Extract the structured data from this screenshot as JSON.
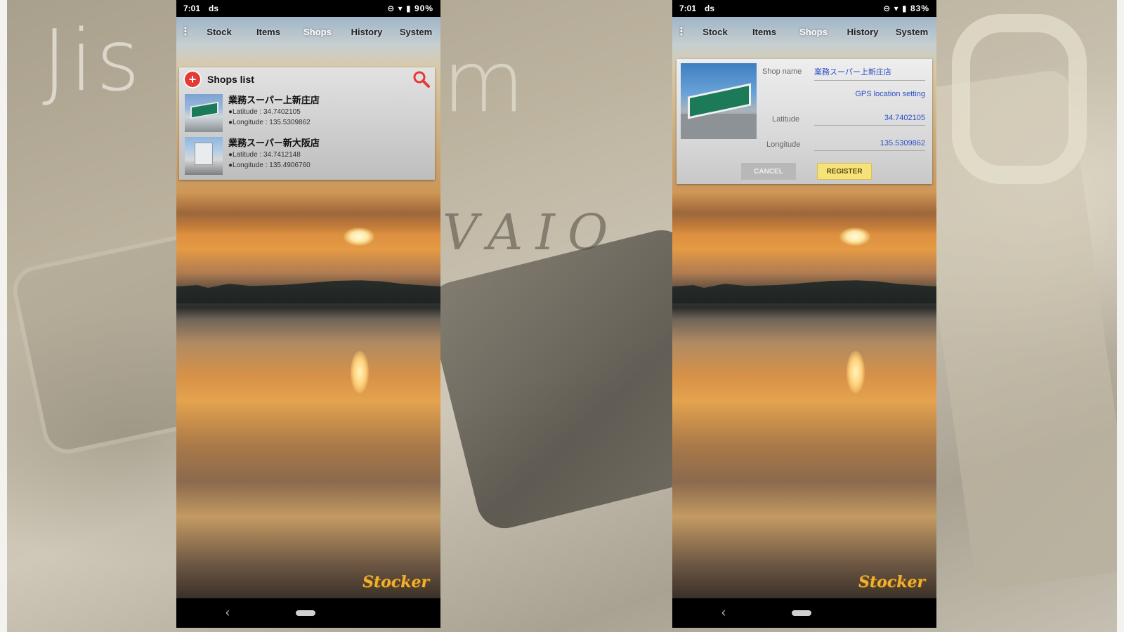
{
  "background": {
    "watermark": "Jis",
    "watermark_tail": "m",
    "logo_text": "VAIO"
  },
  "left_phone": {
    "status": {
      "time": "7:01",
      "carrier_icon": "ds",
      "right": "⊖ ▾ ▮ 90%"
    },
    "menu": {
      "dots": "⋮",
      "tabs": [
        "Stock",
        "Items",
        "Shops",
        "History",
        "System"
      ],
      "active": "Shops"
    },
    "panel": {
      "title": "Shops list",
      "rows": [
        {
          "name": "業務スーパー上新庄店",
          "latitude": "●Latitude : 34.7402105",
          "longitude": "●Longitude : 135.5309862"
        },
        {
          "name": "業務スーパー新大阪店",
          "latitude": "●Latitude : 34.7412148",
          "longitude": "●Longitude : 135.4906760"
        }
      ]
    },
    "brand": "Stocker",
    "nav": {
      "back": "‹"
    }
  },
  "right_phone": {
    "status": {
      "time": "7:01",
      "carrier_icon": "ds",
      "right": "⊖ ▾ ▮ 83%"
    },
    "menu": {
      "dots": "⋮",
      "tabs": [
        "Stock",
        "Items",
        "Shops",
        "History",
        "System"
      ],
      "active": "Shops"
    },
    "detail": {
      "shop_name_label": "Shop name",
      "shop_name_value": "業務スーパー上新庄店",
      "gps_link": "GPS location setting",
      "latitude_label": "Latitude",
      "latitude_value": "34.7402105",
      "longitude_label": "Longitude",
      "longitude_value": "135.5309862",
      "cancel": "CANCEL",
      "register": "REGISTER"
    },
    "brand": "Stocker",
    "nav": {
      "back": "‹"
    }
  },
  "colors": {
    "accent_red": "#e53935",
    "link_blue": "#2a4fc6",
    "register_yellow": "#f6e27a"
  }
}
